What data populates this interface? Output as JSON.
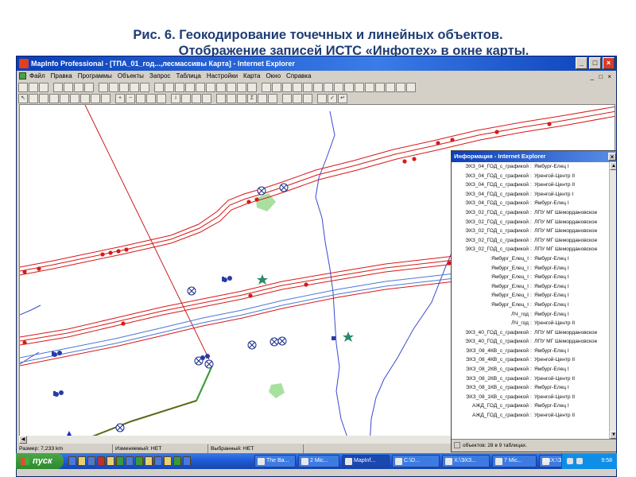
{
  "caption": {
    "line1": "Рис. 6. Геокодирование точечных и линейных объектов.",
    "line2": "Отображение записей ИСТС «Инфотех» в окне карты."
  },
  "window": {
    "title": "MapInfo Professional - [ТПА_01_год...,лесмассивы Карта] - Internet Explorer",
    "controls": [
      "_",
      "□",
      "×"
    ]
  },
  "menu": {
    "items": [
      "Файл",
      "Правка",
      "Программы",
      "Объекты",
      "Запрос",
      "Таблица",
      "Настройки",
      "Карта",
      "Окно",
      "Справка"
    ],
    "mdi_controls": "_ □ ×"
  },
  "info_window": {
    "title": "Информация - Internet Explorer",
    "rows": [
      {
        "key": "ЭХЗ_04_ГОД_с_графикой",
        "value": "Ямбург-Елец I"
      },
      {
        "key": "ЭХЗ_04_ГОД_с_графикой",
        "value": "Уренгой-Центр II"
      },
      {
        "key": "ЭХЗ_04_ГОД_с_графикой",
        "value": "Уренгой-Центр II"
      },
      {
        "key": "ЭХЗ_04_ГОД_с_графикой",
        "value": "Уренгой-Центр I"
      },
      {
        "key": "ЭХЗ_04_ГОД_с_графикой",
        "value": "Ямбург-Елец I"
      },
      {
        "key": "ЭХЗ_02_ГОД_с_графикой",
        "value": "ЛПУ МГ Шемордановское"
      },
      {
        "key": "ЭХЗ_02_ГОД_с_графикой",
        "value": "ЛПУ МГ Шемордановское"
      },
      {
        "key": "ЭХЗ_02_ГОД_с_графикой",
        "value": "ЛПУ МГ Шемордановское"
      },
      {
        "key": "ЭХЗ_02_ГОД_с_графикой",
        "value": "ЛПУ МГ Шемордановское"
      },
      {
        "key": "ЭХЗ_02_ГОД_с_графикой",
        "value": "ЛПУ МГ Шемордановское"
      },
      {
        "key": "Ямбург_Елец_I",
        "value": "Ямбург-Елец I"
      },
      {
        "key": "Ямбург_Елец_I",
        "value": "Ямбург-Елец I"
      },
      {
        "key": "Ямбург_Елец_I",
        "value": "Ямбург-Елец I"
      },
      {
        "key": "Ямбург_Елец_I",
        "value": "Ямбург-Елец I"
      },
      {
        "key": "Ямбург_Елец_I",
        "value": "Ямбург-Елец I"
      },
      {
        "key": "Ямбург_Елец_I",
        "value": "Ямбург-Елец I"
      },
      {
        "key": "ЛЧ_год",
        "value": "Ямбург-Елец I"
      },
      {
        "key": "ЛЧ_год",
        "value": "Уренгой-Центр II"
      },
      {
        "key": "ЭХЗ_40_ГОД_с_графикой",
        "value": "ЛПУ МГ Шемордановское"
      },
      {
        "key": "ЭХЗ_40_ГОД_с_графикой",
        "value": "ЛПУ МГ Шемордановское"
      },
      {
        "key": "ЭХЗ_08_4КВ_с_графикой",
        "value": "Ямбург-Елец I"
      },
      {
        "key": "ЭХЗ_08_4КВ_с_графикой",
        "value": "Уренгой-Центр II"
      },
      {
        "key": "ЭХЗ_08_2КВ_с_графикой",
        "value": "Ямбург-Елец I"
      },
      {
        "key": "ЭХЗ_08_2КВ_с_графикой",
        "value": "Уренгой-Центр II"
      },
      {
        "key": "ЭХЗ_08_1КВ_с_графикой",
        "value": "Ямбург-Елец I"
      },
      {
        "key": "ЭХЗ_08_1КВ_с_графикой",
        "value": "Уренгой-Центр II"
      },
      {
        "key": "АЖД_ГОД_с_графикой",
        "value": "Ямбург-Елец I"
      },
      {
        "key": "АЖД_ГОД_с_графикой",
        "value": "Уренгой-Центр II"
      }
    ],
    "separator": ":",
    "status": "объектов: 28 в 9 таблицах."
  },
  "status_bar": {
    "size": "Размер: 7,233 km",
    "editable": "Изменяемый: НЕТ",
    "selectable": "Выбранный: НЕТ"
  },
  "taskbar": {
    "start_label": "пуск",
    "tasks": [
      "The Ba...",
      "2 Mic...",
      "MapInf...",
      "C:\\D...",
      "Х:\\ЭХЗ...",
      "7 Mic...",
      "Х:\\ЭХ..."
    ],
    "lang": "EN",
    "clock": "9:58"
  },
  "colors": {
    "pipeline": "#d81818",
    "pipeline_blue": "#4a78d8",
    "river": "#3a4ad0",
    "diagonal_line": "#c82020",
    "branch_line": "#5a6a18",
    "forest": "#a8e0a0",
    "titlebar": "#0a3fb8"
  },
  "icons": {
    "symbol_on_line": "circle-x-marker",
    "station": "blue-triangle",
    "flag": "star-marker"
  }
}
